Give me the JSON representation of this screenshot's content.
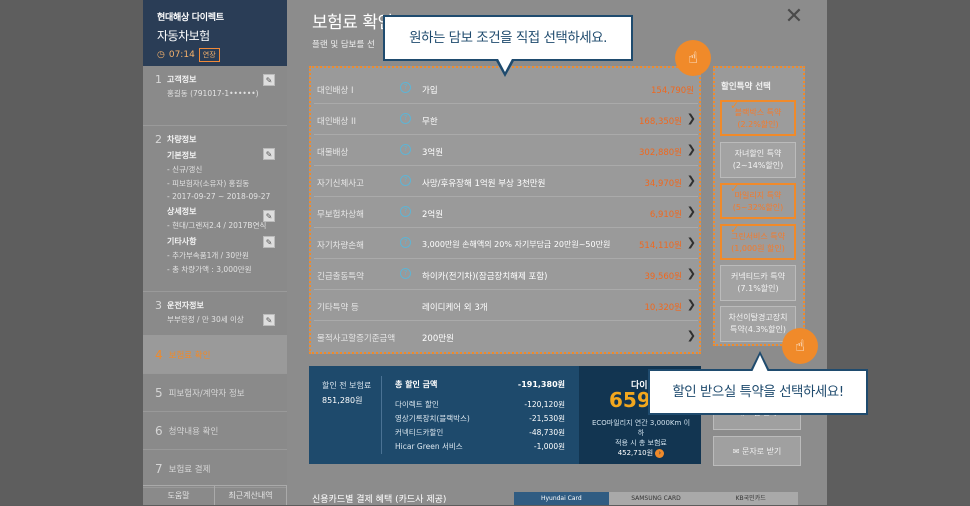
{
  "brand": {
    "company": "현대해상 다이렉트",
    "product": "자동차보험",
    "time": "07:14",
    "extend": "연장"
  },
  "steps": [
    {
      "num": "1",
      "title": "고객정보",
      "lines": [
        "홍길동 (791017-1••••••)"
      ]
    },
    {
      "num": "2",
      "title": "차량정보",
      "sub1": "기본정보",
      "lines1": [
        "- 신규/갱신",
        "- 피보험자(소유자) 홍길동",
        "- 2017-09-27 ~ 2018-09-27"
      ],
      "sub2": "상세정보",
      "lines2": [
        "- 현대/그랜저2.4 / 2017B연식"
      ],
      "sub3": "기타사항",
      "lines3": [
        "- 추가부속품1개 / 30만원",
        "- 총 차량가액 : 3,000만원"
      ]
    },
    {
      "num": "3",
      "title": "운전자정보",
      "lines": [
        "부부한정 / 만 30세 이상"
      ]
    }
  ],
  "nav": [
    {
      "num": "4",
      "label": "보험료 확인"
    },
    {
      "num": "5",
      "label": "피보험자/계약자 정보"
    },
    {
      "num": "6",
      "label": "청약내용 확인"
    },
    {
      "num": "7",
      "label": "보험료 결제"
    }
  ],
  "bottom_buttons": [
    "도움말",
    "최근계산내역"
  ],
  "page": {
    "title": "보험료 확인",
    "subtitle": "플랜 및 담보를 선"
  },
  "coverages": [
    {
      "name": "대인배상 I",
      "value": "가입",
      "price": "154,790원"
    },
    {
      "name": "대인배상 II",
      "value": "무한",
      "price": "168,350원"
    },
    {
      "name": "대물배상",
      "value": "3억원",
      "price": "302,880원"
    },
    {
      "name": "자기신체사고",
      "value": "사망/후유장해 1억원 부상 3천만원",
      "price": "34,970원"
    },
    {
      "name": "무보험차상해",
      "value": "2억원",
      "price": "6,910원"
    },
    {
      "name": "자기차량손해",
      "value": "3,000만원 손해액의 20% 자기부담금 20만원~50만원",
      "price": "514,110원"
    },
    {
      "name": "긴급출동특약",
      "value": "하이카(전기차)(잠금장치해제 포함)",
      "price": "39,560원"
    },
    {
      "name": "기타특약 등",
      "value": "레이디케어 외 3개",
      "price": "10,320원"
    },
    {
      "name": "물적사고할증기준금액",
      "value": "200만원",
      "price": ""
    }
  ],
  "discounts": {
    "title": "할인특약 선택",
    "items": [
      {
        "line1": "블랙박스 특약",
        "line2": "(2.2%할인)",
        "selected": true
      },
      {
        "line1": "자녀할인 특약",
        "line2": "(2~14%할인)",
        "selected": false
      },
      {
        "line1": "마일리지 특약",
        "line2": "(5~32%할인)",
        "selected": true
      },
      {
        "line1": "그린서비스 특약",
        "line2": "(1,000원 할인)",
        "selected": true
      },
      {
        "line1": "커넥티드카 특약",
        "line2": "(7.1%할인)",
        "selected": false
      },
      {
        "line1": "차선이탈경고장치",
        "line2": "특약(4.3%할인)",
        "selected": false
      }
    ]
  },
  "summary": {
    "before_label": "할인 전 보험료",
    "before_value": "851,280원",
    "total_discount_label": "총 할인 금액",
    "total_discount_value": "-191,380원",
    "discount_lines": [
      {
        "label": "다이렉트 할인",
        "value": "-120,120원"
      },
      {
        "label": "영상기록장치(블랙박스)",
        "value": "-21,530원"
      },
      {
        "label": "커넥티드카할인",
        "value": "-48,730원"
      },
      {
        "label": "Hicar Green 서비스",
        "value": "-1,000원"
      }
    ],
    "final_label": "다이",
    "final_amount": "659,",
    "eco_line1": "ECO마일리지 연간 3,000Km 이하",
    "eco_line2": "적용 시 총 보험료",
    "eco_value": "452,710원"
  },
  "actions": {
    "btn1": "재 보험 설계",
    "btn2": "문자로 받기"
  },
  "card_section": {
    "title": "신용카드별 결제 혜택 (카드사 제공)",
    "cards": [
      "Hyundai Card",
      "SAMSUNG CARD",
      "KB국민카드"
    ]
  },
  "tooltips": {
    "coverage": "원하는 담보 조건을 직접 선택하세요.",
    "discount": "할인 받으실 특약을 선택하세요!"
  },
  "colors": {
    "accent": "#f08a2a",
    "navy": "#1f4b6e",
    "price": "#f0681e"
  }
}
